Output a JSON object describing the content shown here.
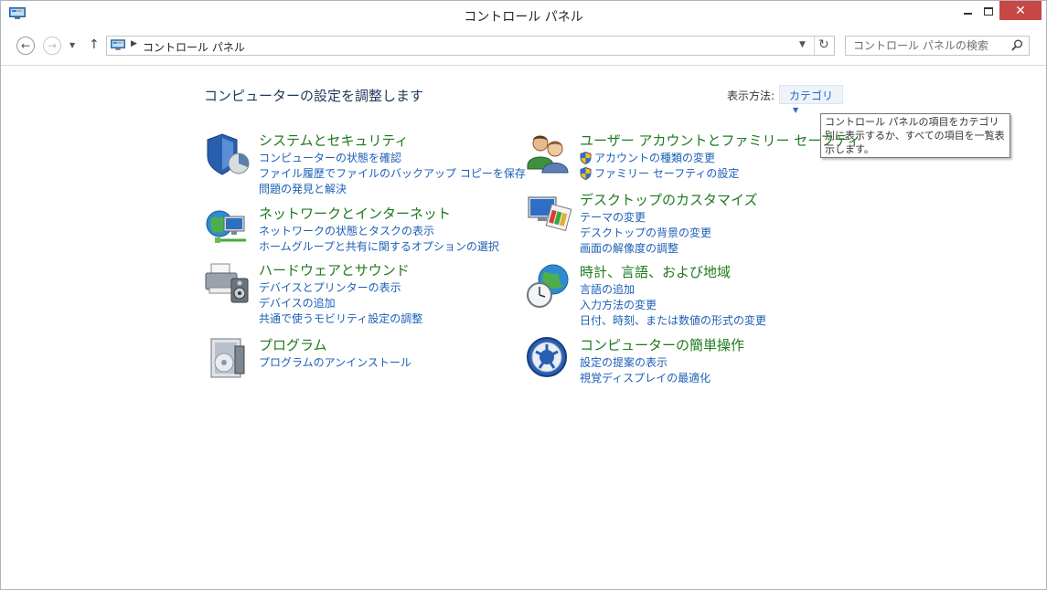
{
  "window": {
    "title": "コントロール パネル"
  },
  "address": {
    "path": "コントロール パネル"
  },
  "search": {
    "placeholder": "コントロール パネルの検索"
  },
  "content": {
    "heading": "コンピューターの設定を調整します",
    "view_by_label": "表示方法:",
    "view_by_value": "カテゴリ",
    "tooltip": "コントロール パネルの項目をカテゴリ別に表示するか、すべての項目を一覧表示します。"
  },
  "categories": {
    "system": {
      "title": "システムとセキュリティ",
      "links": [
        "コンピューターの状態を確認",
        "ファイル履歴でファイルのバックアップ コピーを保存",
        "問題の発見と解決"
      ]
    },
    "network": {
      "title": "ネットワークとインターネット",
      "links": [
        "ネットワークの状態とタスクの表示",
        "ホームグループと共有に関するオプションの選択"
      ]
    },
    "hardware": {
      "title": "ハードウェアとサウンド",
      "links": [
        "デバイスとプリンターの表示",
        "デバイスの追加",
        "共通で使うモビリティ設定の調整"
      ]
    },
    "programs": {
      "title": "プログラム",
      "links": [
        "プログラムのアンインストール"
      ]
    },
    "users": {
      "title": "ユーザー アカウントとファミリー セーフティ",
      "links": [
        "アカウントの種類の変更",
        "ファミリー セーフティの設定"
      ]
    },
    "appearance": {
      "title": "デスクトップのカスタマイズ",
      "links": [
        "テーマの変更",
        "デスクトップの背景の変更",
        "画面の解像度の調整"
      ]
    },
    "clock": {
      "title": "時計、言語、および地域",
      "links": [
        "言語の追加",
        "入力方法の変更",
        "日付、時刻、または数値の形式の変更"
      ]
    },
    "ease": {
      "title": "コンピューターの簡単操作",
      "links": [
        "設定の提案の表示",
        "視覚ディスプレイの最適化"
      ]
    }
  },
  "icons": {
    "app": "control-panel-icon",
    "back": "back-arrow-icon",
    "forward": "forward-arrow-icon",
    "up": "up-arrow-icon",
    "refresh": "refresh-icon",
    "search": "search-icon",
    "uac": "uac-shield-icon"
  },
  "colors": {
    "category_title": "#1e7a1e",
    "link": "#1c5fb6",
    "heading": "#1e395b",
    "close_button": "#c74646"
  }
}
